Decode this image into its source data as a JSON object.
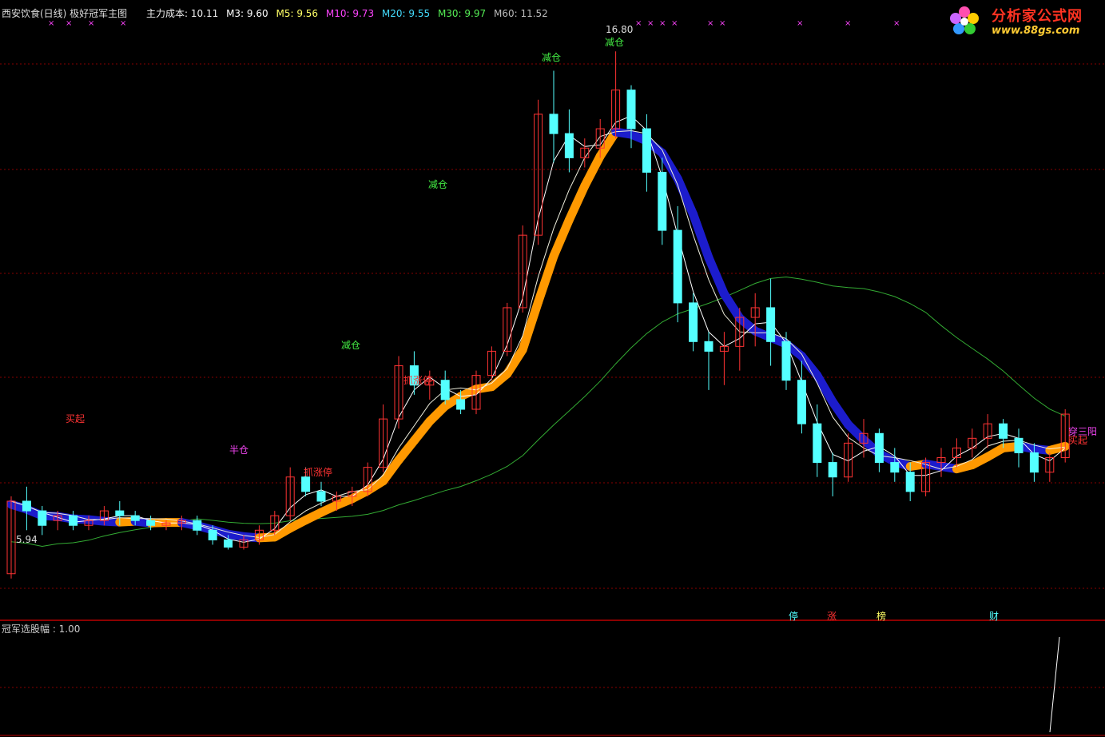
{
  "main_header": {
    "title": "西安饮食(日线) 极好冠军主图",
    "cost_label": "主力成本: 10.11",
    "m3": "M3: 9.60",
    "m5": "M5: 9.56",
    "m10": "M10: 9.73",
    "m20": "M20: 9.55",
    "m30": "M30: 9.97",
    "m60": "M60: 11.52"
  },
  "logo": {
    "name": "分析家公式网",
    "url": "www.88gs.com"
  },
  "price_labels": {
    "high": "16.80",
    "low": "5.94"
  },
  "signal_labels": {
    "reduce": "减仓",
    "limit_up": "抓涨停",
    "half": "半仓",
    "buy_start": "买起",
    "three_yang": "穿三阳"
  },
  "bottom_tags": [
    "停",
    "涨",
    "榜",
    "财"
  ],
  "sub_header": "冠军选股幅 : 1.00",
  "colors": {
    "up": "#ff3333",
    "down": "#54ffff",
    "band_up": "#ff9900",
    "band_down": "#1c1ccc",
    "ma_long": "#33aa33",
    "grid": "#880000"
  },
  "chart_data": {
    "type": "candlestick",
    "y_axis_range": [
      5.5,
      17.3
    ],
    "series": [
      {
        "name": "K线",
        "ohlc": [
          [
            6.0,
            7.6,
            5.9,
            7.5
          ],
          [
            7.5,
            7.8,
            6.9,
            7.3
          ],
          [
            7.3,
            7.4,
            6.8,
            7.0
          ],
          [
            7.1,
            7.3,
            6.9,
            7.2
          ],
          [
            7.2,
            7.3,
            6.9,
            7.0
          ],
          [
            7.0,
            7.2,
            6.9,
            7.1
          ],
          [
            7.1,
            7.4,
            7.0,
            7.3
          ],
          [
            7.3,
            7.5,
            7.0,
            7.2
          ],
          [
            7.2,
            7.3,
            7.0,
            7.1
          ],
          [
            7.1,
            7.2,
            6.9,
            7.0
          ],
          [
            7.0,
            7.1,
            6.9,
            7.05
          ],
          [
            7.05,
            7.2,
            6.9,
            7.1
          ],
          [
            7.1,
            7.2,
            6.8,
            6.9
          ],
          [
            6.9,
            7.0,
            6.6,
            6.7
          ],
          [
            6.7,
            6.8,
            6.5,
            6.55
          ],
          [
            6.55,
            6.8,
            6.5,
            6.7
          ],
          [
            6.7,
            7.0,
            6.6,
            6.9
          ],
          [
            6.9,
            7.3,
            6.8,
            7.2
          ],
          [
            7.2,
            8.2,
            7.1,
            8.0
          ],
          [
            8.0,
            8.2,
            7.6,
            7.7
          ],
          [
            7.7,
            7.9,
            7.4,
            7.5
          ],
          [
            7.5,
            7.7,
            7.3,
            7.6
          ],
          [
            7.6,
            7.8,
            7.4,
            7.7
          ],
          [
            7.7,
            8.3,
            7.6,
            8.2
          ],
          [
            8.2,
            9.5,
            8.1,
            9.2
          ],
          [
            9.2,
            10.5,
            9.0,
            10.3
          ],
          [
            10.3,
            10.6,
            9.7,
            9.9
          ],
          [
            9.9,
            10.2,
            9.6,
            10.0
          ],
          [
            10.0,
            10.2,
            9.5,
            9.6
          ],
          [
            9.6,
            9.8,
            9.3,
            9.4
          ],
          [
            9.4,
            10.2,
            9.3,
            10.1
          ],
          [
            10.1,
            10.7,
            10.0,
            10.6
          ],
          [
            10.6,
            11.6,
            10.5,
            11.5
          ],
          [
            11.5,
            13.2,
            11.4,
            13.0
          ],
          [
            13.0,
            15.8,
            12.8,
            15.5
          ],
          [
            15.5,
            16.4,
            14.5,
            15.1
          ],
          [
            15.1,
            15.6,
            14.3,
            14.6
          ],
          [
            14.6,
            15.0,
            14.4,
            14.8
          ],
          [
            14.8,
            15.4,
            14.6,
            15.2
          ],
          [
            15.2,
            16.8,
            15.0,
            16.0
          ],
          [
            16.0,
            16.1,
            14.8,
            15.2
          ],
          [
            15.2,
            15.5,
            13.9,
            14.3
          ],
          [
            14.3,
            14.6,
            12.8,
            13.1
          ],
          [
            13.1,
            13.6,
            11.2,
            11.6
          ],
          [
            11.6,
            11.8,
            10.6,
            10.8
          ],
          [
            10.8,
            11.0,
            9.8,
            10.6
          ],
          [
            10.6,
            11.0,
            9.9,
            10.7
          ],
          [
            10.7,
            11.5,
            10.2,
            11.3
          ],
          [
            11.3,
            11.8,
            10.7,
            11.5
          ],
          [
            11.5,
            12.1,
            10.3,
            10.8
          ],
          [
            10.8,
            11.0,
            9.8,
            10.0
          ],
          [
            10.0,
            10.4,
            8.9,
            9.1
          ],
          [
            9.1,
            9.5,
            8.0,
            8.3
          ],
          [
            8.3,
            8.5,
            7.6,
            8.0
          ],
          [
            8.0,
            8.9,
            7.9,
            8.7
          ],
          [
            8.7,
            9.2,
            8.4,
            8.9
          ],
          [
            8.9,
            9.0,
            8.1,
            8.3
          ],
          [
            8.3,
            8.6,
            7.9,
            8.1
          ],
          [
            8.1,
            8.3,
            7.5,
            7.7
          ],
          [
            7.7,
            8.4,
            7.6,
            8.3
          ],
          [
            8.3,
            8.6,
            8.0,
            8.4
          ],
          [
            8.4,
            8.8,
            8.2,
            8.6
          ],
          [
            8.6,
            9.0,
            8.4,
            8.8
          ],
          [
            8.8,
            9.3,
            8.6,
            9.1
          ],
          [
            9.1,
            9.2,
            8.6,
            8.8
          ],
          [
            8.8,
            9.0,
            8.2,
            8.5
          ],
          [
            8.5,
            8.7,
            7.9,
            8.1
          ],
          [
            8.1,
            8.5,
            7.9,
            8.4
          ],
          [
            8.4,
            9.4,
            8.3,
            9.3
          ]
        ]
      }
    ]
  }
}
